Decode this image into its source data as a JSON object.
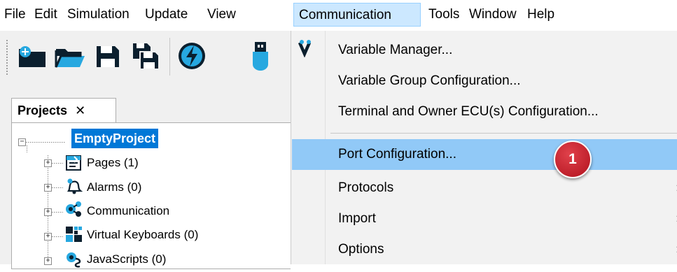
{
  "menubar": {
    "items": [
      {
        "label": "File"
      },
      {
        "label": "Edit"
      },
      {
        "label": "Simulation"
      },
      {
        "label": "Update"
      },
      {
        "label": "View"
      },
      {
        "label": "Communication"
      },
      {
        "label": "Tools"
      },
      {
        "label": "Window"
      },
      {
        "label": "Help"
      }
    ],
    "active": "Communication"
  },
  "toolbar": {
    "buttons": [
      "new-project-icon",
      "open-folder-icon",
      "save-icon",
      "save-all-icon",
      "connect-icon",
      "usb-icon"
    ]
  },
  "projects_panel": {
    "tab_label": "Projects",
    "close_glyph": "✕",
    "root": "EmptyProject",
    "items": [
      {
        "label": "Pages (1)",
        "icon": "pages-icon"
      },
      {
        "label": "Alarms (0)",
        "icon": "alarm-bell-icon"
      },
      {
        "label": "Communication",
        "icon": "communication-icon"
      },
      {
        "label": "Virtual Keyboards (0)",
        "icon": "keyboard-icon"
      },
      {
        "label": "JavaScripts (0)",
        "icon": "javascript-icon"
      }
    ]
  },
  "communication_menu": {
    "items": [
      {
        "label": "Variable Manager...",
        "icon": "variable-manager-icon"
      },
      {
        "label": "Variable Group Configuration..."
      },
      {
        "label": "Terminal and Owner ECU(s) Configuration..."
      },
      {
        "label": "Port Configuration...",
        "highlighted": true
      },
      {
        "label": "Protocols",
        "submenu": true
      },
      {
        "label": "Import",
        "submenu": true
      },
      {
        "label": "Options",
        "submenu": true
      }
    ],
    "submenu_glyph": "›"
  },
  "callout": {
    "number": "1"
  },
  "colors": {
    "highlight": "#91c9f7",
    "menu_active": "#cce8ff",
    "selection": "#0078d7",
    "badge": "#c8202c"
  }
}
